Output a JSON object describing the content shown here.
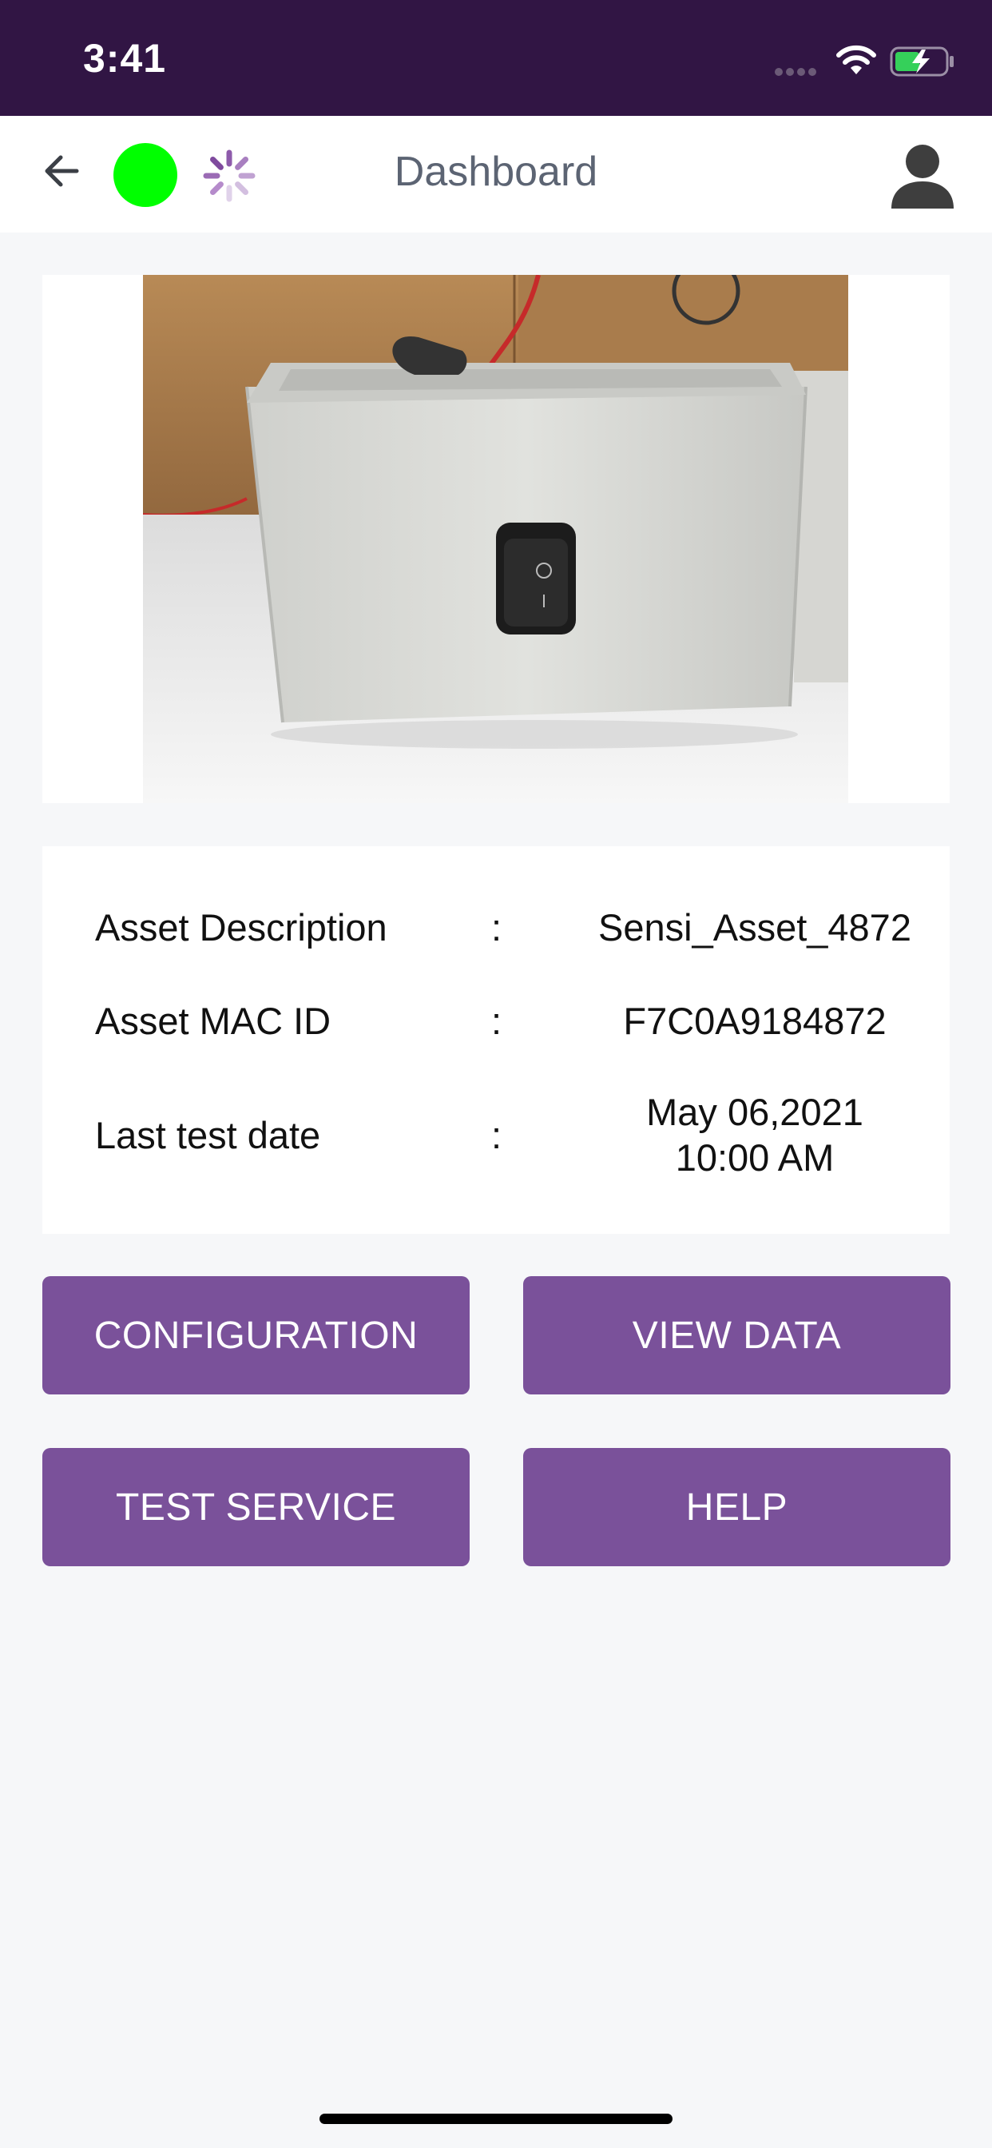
{
  "status_bar": {
    "time": "3:41",
    "icons": [
      "signal-icon",
      "wifi-icon",
      "battery-charging-icon"
    ]
  },
  "nav": {
    "title": "Dashboard",
    "icons": [
      "back-arrow-icon",
      "connection-status-dot",
      "loading-spinner-icon",
      "user-avatar-icon"
    ],
    "connection_color": "#00ff00"
  },
  "asset_image": {
    "alt": "Photo of asset enclosure with rocker switch"
  },
  "info": {
    "rows": [
      {
        "label": "Asset Description",
        "value": "Sensi_Asset_4872"
      },
      {
        "label": "Asset MAC ID",
        "value": "F7C0A9184872"
      },
      {
        "label": "Last test date",
        "value_line1": "May 06,2021",
        "value_line2": "10:00 AM"
      }
    ],
    "separator": ":"
  },
  "buttons": {
    "configuration": "CONFIGURATION",
    "view_data": "VIEW DATA",
    "test_service": "TEST SERVICE",
    "help": "HELP"
  },
  "colors": {
    "status_bar": "#311544",
    "button": "#7a519a",
    "background": "#f6f7f9"
  }
}
